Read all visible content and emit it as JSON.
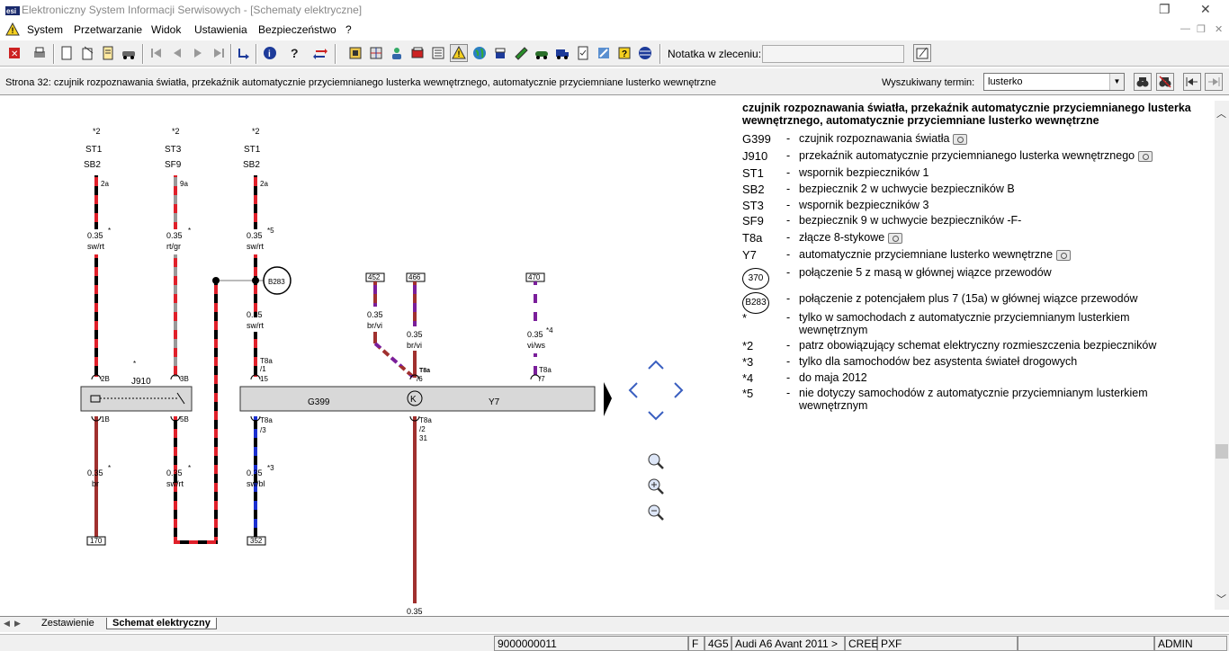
{
  "window": {
    "title": "Elektroniczny System Informacji Serwisowych - [Schematy elektryczne]",
    "controls": {
      "restore": "❐",
      "close": "✕"
    }
  },
  "menu": {
    "items": [
      "System",
      "Przetwarzanie",
      "Widok",
      "Ustawienia",
      "Bezpieczeństwo",
      "?"
    ],
    "mdi_controls": {
      "minimize": "—",
      "restore": "❐",
      "close": "✕"
    }
  },
  "toolbar": {
    "notatka_label": "Notatka w zleceniu:",
    "notatka_value": ""
  },
  "infobar": {
    "page_text": "Strona 32: czujnik rozpoznawania światła, przekaźnik automatycznie przyciemnianego lusterka wewnętrznego, automatycznie przyciemniane lusterko wewnętrzne",
    "search_label": "Wyszukiwany termin:",
    "search_value": "lusterko"
  },
  "legend": {
    "title": "czujnik rozpoznawania światła, przekaźnik automatycznie przyciemnianego lusterka wewnętrznego, automatycznie przyciemniane lusterko wewnętrzne",
    "items": [
      {
        "code": "G399",
        "desc": "czujnik rozpoznawania światła",
        "camera": true
      },
      {
        "code": "J910",
        "desc": "przekaźnik automatycznie przyciemnianego lusterka wewnętrznego",
        "camera": true
      },
      {
        "code": "ST1",
        "desc": "wspornik bezpieczników 1",
        "camera": false
      },
      {
        "code": "SB2",
        "desc": "bezpiecznik 2 w uchwycie bezpieczników  B",
        "camera": false
      },
      {
        "code": "ST3",
        "desc": "wspornik bezpieczników 3",
        "camera": false
      },
      {
        "code": "SF9",
        "desc": "bezpiecznik 9 w uchwycie bezpieczników -F-",
        "camera": false
      },
      {
        "code": "T8a",
        "desc": "złącze 8-stykowe",
        "camera": true
      },
      {
        "code": "Y7",
        "desc": "automatycznie przyciemniane lusterko wewnętrzne",
        "camera": true
      },
      {
        "code": "370",
        "desc": "połączenie 5 z masą w głównej wiązce przewodów",
        "circle": true
      },
      {
        "code": "B283",
        "desc": "połączenie z potencjałem plus 7 (15a) w głównej wiązce przewodów",
        "circle": true
      },
      {
        "code": "*",
        "desc": "tylko w samochodach z automatycznie przyciemnianym lusterkiem wewnętrznym"
      },
      {
        "code": "*2",
        "desc": "patrz obowiązujący schemat elektryczny rozmieszczenia bezpieczników"
      },
      {
        "code": "*3",
        "desc": "tylko dla samochodów bez asystenta świateł drogowych"
      },
      {
        "code": "*4",
        "desc": "do maja 2012"
      },
      {
        "code": "*5",
        "desc": "nie dotyczy samochodów z automatycznie przyciemnianym lusterkiem wewnętrznym"
      }
    ]
  },
  "diagram": {
    "fuses": [
      {
        "ref": "*2",
        "holder": "ST1",
        "fuse": "SB2",
        "pin": "2a",
        "wire": "0.35",
        "color": "sw/rt",
        "mark": "*"
      },
      {
        "ref": "*2",
        "holder": "ST3",
        "fuse": "SF9",
        "pin": "9a",
        "wire": "0.35",
        "color": "rt/gr",
        "mark": "*"
      },
      {
        "ref": "*2",
        "holder": "ST1",
        "fuse": "SB2",
        "pin": "2a",
        "wire": "0.35",
        "color": "sw/rt",
        "mark": "*5"
      }
    ],
    "labels": {
      "j910": "J910",
      "j910_star": "*",
      "g399": "G399",
      "y7": "Y7",
      "b283": "B283",
      "pin_2b": "2B",
      "pin_3b": "3B",
      "pin_1b": "1B",
      "pin_5b": "5B",
      "t8a": "T8a",
      "t8a_1": "/1",
      "t8a_15": "15",
      "t8a_3": "/3",
      "t8a_2": "/2",
      "t8a_31": "31",
      "t8a_6": "/6",
      "t8a_7": "/7",
      "t8a_s": "T8a",
      "w035": "0.35",
      "sw_rt": "sw/rt",
      "br": "br",
      "sw_bl": "sw/bl",
      "br_vi": "br/vi",
      "vi_ws": "vi/ws",
      "star": "*",
      "star3": "*3",
      "star4": "*4",
      "g452": "452",
      "g466": "466",
      "g470": "470",
      "g170": "170",
      "g352": "352"
    }
  },
  "tabs": {
    "items": [
      "Zestawienie",
      "Schemat elektryczny"
    ],
    "active": 1
  },
  "status": {
    "doc": "9000000011",
    "f": "F",
    "code": "4G5",
    "vehicle": "Audi A6 Avant 2011 >",
    "eng": "CREE",
    "gear": "PXF",
    "user": "ADMIN"
  }
}
